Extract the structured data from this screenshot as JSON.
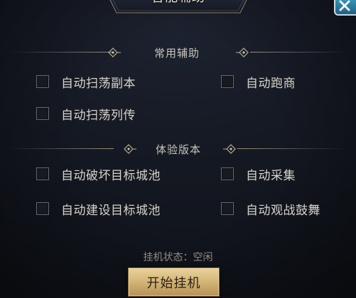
{
  "window": {
    "title": "智能辅助"
  },
  "colors": {
    "gold_accent": "#d4b578",
    "text": "#d6d3c8",
    "muted": "#8f8b84"
  },
  "sections": [
    {
      "title": "常用辅助",
      "options": [
        {
          "label": "自动扫荡副本",
          "checked": false
        },
        {
          "label": "自动跑商",
          "checked": false
        },
        {
          "label": "自动扫荡列传",
          "checked": false
        }
      ]
    },
    {
      "title": "体验版本",
      "options": [
        {
          "label": "自动破坏目标城池",
          "checked": false
        },
        {
          "label": "自动采集",
          "checked": false
        },
        {
          "label": "自动建设目标城池",
          "checked": false
        },
        {
          "label": "自动观战鼓舞",
          "checked": false
        }
      ]
    }
  ],
  "status": {
    "text": "挂机状态：空闲"
  },
  "start_button": {
    "label": "开始挂机"
  }
}
